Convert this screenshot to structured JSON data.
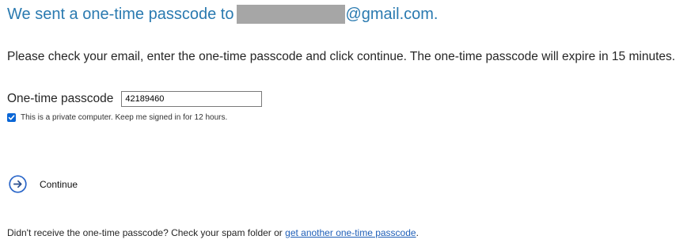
{
  "heading": {
    "prefix": "We sent a one-time passcode to",
    "suffix": "@gmail.com."
  },
  "instructions": "Please check your email, enter the one-time passcode and click continue. The one-time passcode will expire in 15 minutes.",
  "passcode": {
    "label": "One-time passcode",
    "value": "42189460"
  },
  "keep_signed_in": {
    "checked": true,
    "label": "This is a private computer. Keep me signed in for 12 hours."
  },
  "continue": {
    "label": "Continue",
    "icon": "arrow-right-circle-icon"
  },
  "footer": {
    "text": "Didn't receive the one-time passcode? Check your spam folder or",
    "link": "get another one-time passcode",
    "end": "."
  },
  "colors": {
    "heading": "#2a7ab0",
    "link": "#1f5fb8",
    "accent": "#0a66d6",
    "redaction": "#a6a6a6"
  }
}
